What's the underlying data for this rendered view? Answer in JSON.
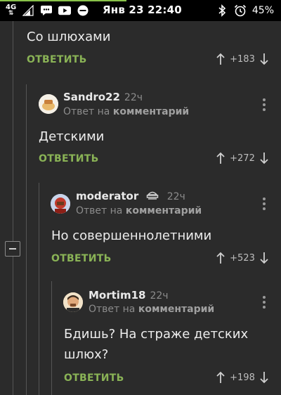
{
  "status_bar": {
    "network": "4G",
    "time": "Янв 23 22:40",
    "battery": "45%",
    "icons": [
      "signal-icon",
      "sms-icon",
      "youtube-icon",
      "do-not-disturb-icon",
      "bluetooth-icon",
      "alarm-icon"
    ],
    "progress_fraction": 0.45,
    "colors": {
      "progress": "#8ac34a"
    }
  },
  "colors": {
    "accent": "#8ab356",
    "background": "#2b2b2b",
    "muted": "#8c8c8c"
  },
  "comments": [
    {
      "text": "Со шлюхами",
      "reply_label": "ОТВЕТИТЬ",
      "score": "+183"
    },
    {
      "username": "Sandro22",
      "time": "22ч",
      "meta_prefix": "Ответ на",
      "meta_link": "комментарий",
      "text": "Детскими",
      "reply_label": "ОТВЕТИТЬ",
      "score": "+272"
    },
    {
      "username": "moderator",
      "time": "22ч",
      "meta_prefix": "Ответ на",
      "meta_link": "комментарий",
      "text": "Но совершеннолетними",
      "reply_label": "ОТВЕТИТЬ",
      "score": "+523"
    },
    {
      "username": "Mortim18",
      "time": "22ч",
      "meta_prefix": "Ответ на",
      "meta_link": "комментарий",
      "text_line1": "Бдишь? На страже детских",
      "text_line2": "шлюх?",
      "reply_label": "ОТВЕТИТЬ",
      "score": "+198"
    }
  ]
}
